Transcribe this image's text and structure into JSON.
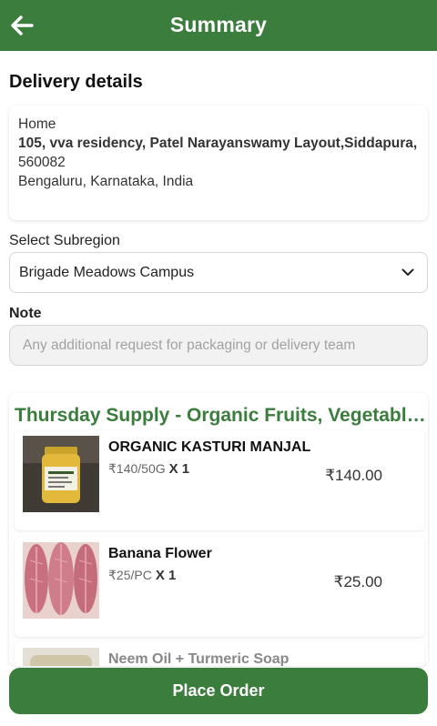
{
  "header": {
    "title": "Summary"
  },
  "delivery": {
    "section_title": "Delivery details",
    "address_type": "Home",
    "address_line": "105, vva residency, Patel Narayanswamy Layout,Siddapura,",
    "pincode": "560082",
    "city_line": "Bengaluru, Karnataka, India"
  },
  "subregion": {
    "label": "Select Subregion",
    "value": "Brigade Meadows Campus"
  },
  "note": {
    "label": "Note",
    "placeholder": "Any additional request for packaging or delivery team",
    "value": ""
  },
  "order": {
    "supply_title": "Thursday Supply - Organic Fruits, Vegetables",
    "items": [
      {
        "name": "ORGANIC KASTURI MANJAL",
        "unit_price": "₹140/50G",
        "qty": "X 1",
        "total": "₹140.00",
        "image_icon": "turmeric-jar"
      },
      {
        "name": "Banana Flower",
        "unit_price": "₹25/PC",
        "qty": "X 1",
        "total": "₹25.00",
        "image_icon": "banana-flower"
      },
      {
        "name": "Neem Oil + Turmeric Soap",
        "image_icon": "soap"
      }
    ]
  },
  "actions": {
    "place_order_label": "Place Order"
  },
  "colors": {
    "primary": "#3a7d3c",
    "background": "#ffffff"
  }
}
